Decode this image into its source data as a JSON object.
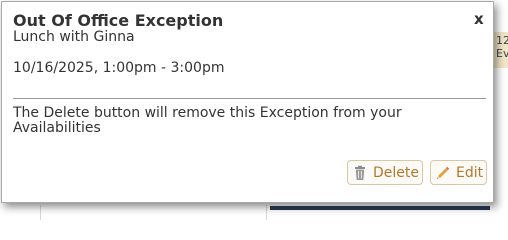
{
  "background": {
    "calendar_snippet": "12\nEv"
  },
  "dialog": {
    "title": "Out Of Office Exception",
    "close_label": "x",
    "subtitle": "Lunch with Ginna",
    "datetime": "10/16/2025, 1:00pm - 3:00pm",
    "note": "The Delete button will remove this Exception from your Availabilities",
    "delete_label": "Delete",
    "edit_label": "Edit"
  },
  "colors": {
    "button_text": "#b4782c",
    "button_border": "#d9c9a3",
    "divider": "#9a9a9a"
  },
  "icons": {
    "delete": "trash-icon",
    "edit": "pencil-icon"
  }
}
